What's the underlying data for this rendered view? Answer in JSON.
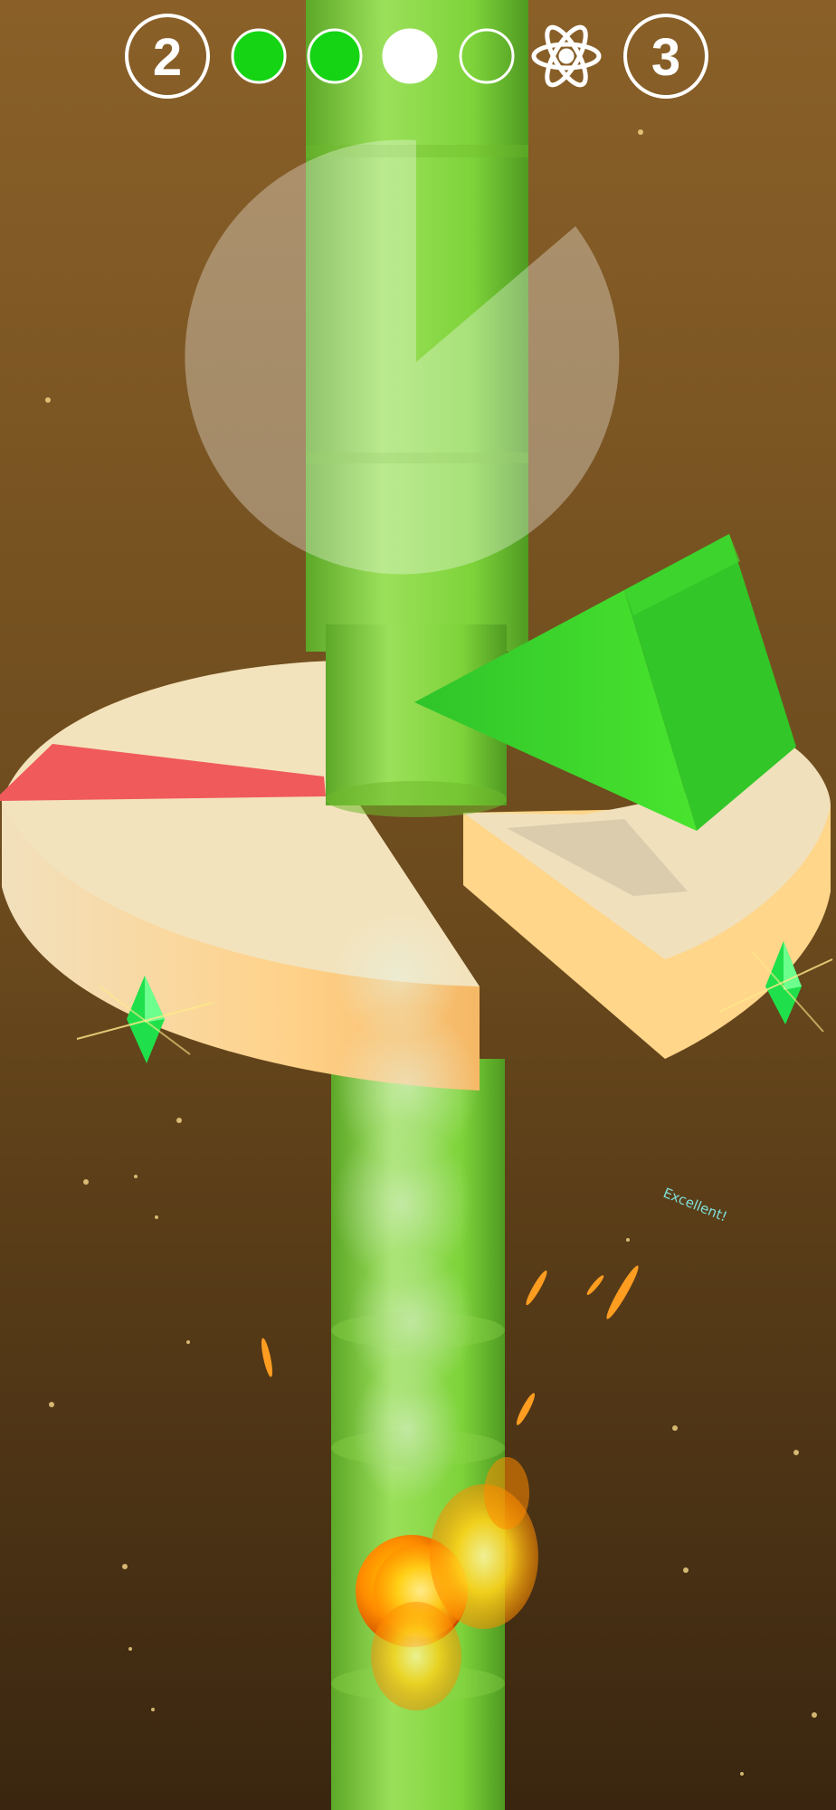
{
  "hud": {
    "current_level": "2",
    "next_level": "3",
    "stage_dots": [
      {
        "state": "complete",
        "color": "#14d414"
      },
      {
        "state": "complete",
        "color": "#14d414"
      },
      {
        "state": "current",
        "color": "#ffffff"
      },
      {
        "state": "upcoming",
        "color": "#5a7a32"
      }
    ],
    "next_level_icon": "atom-icon"
  },
  "feedback": {
    "praise_text": "Excellent!"
  },
  "colors": {
    "background_top": "#8a6028",
    "background_bottom": "#3a2610",
    "column": "#7ed33a",
    "platform_top": "#f3e3bd",
    "platform_side": "#f7c372",
    "danger_segment": "#f05a5a",
    "wedge": "#33d12a",
    "gem": "#1fe04a",
    "ball": "#ff7a00"
  },
  "icons": [
    "atom-icon",
    "gem-icon",
    "fire-ball-icon",
    "ghost-circle"
  ]
}
